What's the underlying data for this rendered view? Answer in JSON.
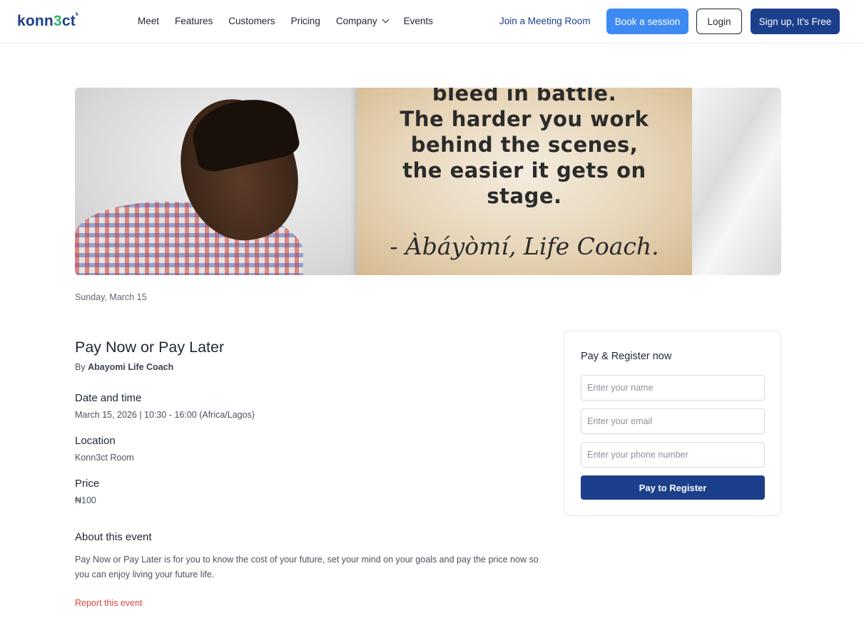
{
  "header": {
    "logo_text_1": "konn",
    "logo_text_2": "3",
    "logo_text_3": "ct",
    "logo_mark": "k",
    "nav": [
      "Meet",
      "Features",
      "Customers",
      "Pricing",
      "Company",
      "Events"
    ],
    "join_link": "Join a Meeting Room",
    "book_button": "Book a session",
    "login_button": "Login",
    "signup_button": "Sign up, It's Free"
  },
  "banner": {
    "quote_lines": [
      "bleed in battle.",
      "The harder you work",
      "behind the scenes,",
      "the easier it gets on",
      "stage."
    ],
    "signature": "- Àbáyòmí, Life Coach."
  },
  "event": {
    "date_short": "Sunday, March 15",
    "title": "Pay Now or Pay Later",
    "by_prefix": "By",
    "organizer": "Abayomi Life Coach",
    "datetime_label": "Date and time",
    "datetime_value": "March 15, 2026 | 10:30 - 16:00 (Africa/Lagos)",
    "location_label": "Location",
    "location_value": "Konn3ct Room",
    "price_label": "Price",
    "price_value": "₦100",
    "about_label": "About this event",
    "about_text": "Pay Now or Pay Later is for you to know the cost of your future, set your mind on your goals and pay the price now so you can enjoy living your future life.",
    "report_link": "Report this event"
  },
  "register": {
    "title": "Pay & Register now",
    "name_placeholder": "Enter your name",
    "email_placeholder": "Enter your email",
    "phone_placeholder": "Enter your phone number",
    "submit_label": "Pay to Register"
  }
}
